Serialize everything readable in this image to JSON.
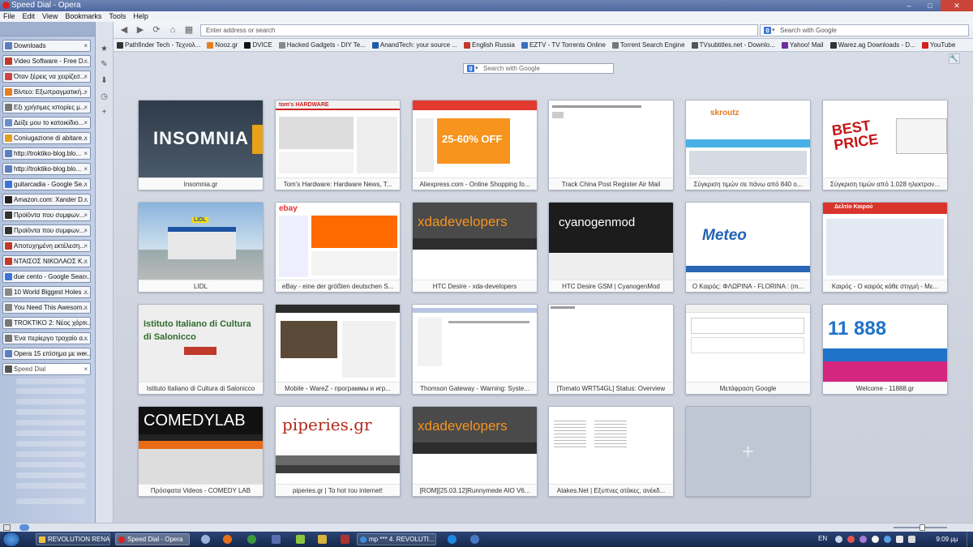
{
  "window": {
    "title": "Speed Dial - Opera"
  },
  "menu": [
    "File",
    "Edit",
    "View",
    "Bookmarks",
    "Tools",
    "Help"
  ],
  "tabs": [
    {
      "label": "Downloads",
      "color": "#5b7fbf"
    },
    {
      "label": "Video Software - Free D...",
      "color": "#c0392b"
    },
    {
      "label": "Όταν ξέρεις να χειρίζεσ...",
      "color": "#c44"
    },
    {
      "label": "Βίντεο: Εξωπραγματική...",
      "color": "#e67e22"
    },
    {
      "label": "Εξι χρήσιμες ιστορίες μ...",
      "color": "#777"
    },
    {
      "label": "Δείξε μου το κατοικίδιο...",
      "color": "#6a8fcf"
    },
    {
      "label": "Coniugazione di abitare...",
      "color": "#e2a020"
    },
    {
      "label": "http://troktiko-blog.blo...",
      "color": "#5b7fbf"
    },
    {
      "label": "http://troktiko-blog.blo...",
      "color": "#5b7fbf"
    },
    {
      "label": "guitarcadia - Google Se...",
      "color": "#3a75d8"
    },
    {
      "label": "Amazon.com: Xander D...",
      "color": "#222"
    },
    {
      "label": "Προϊόντα που συμφων...",
      "color": "#333"
    },
    {
      "label": "Προϊόντα που συμφων...",
      "color": "#333"
    },
    {
      "label": "Αποτυχημένη εκτέλεση...",
      "color": "#c0392b"
    },
    {
      "label": "ΝΤΑΙΣΟΣ ΝΙΚΟΛΑΟΣ Κ...",
      "color": "#c0392b"
    },
    {
      "label": "due cento - Google Sear...",
      "color": "#3a75d8"
    },
    {
      "label": "10 World Biggest Holes ...",
      "color": "#888"
    },
    {
      "label": "You Need This Awesom...",
      "color": "#888"
    },
    {
      "label": "TROKTIKO 2: Νέος χάρτ...",
      "color": "#777"
    },
    {
      "label": "Ένα περίεργο τροχαίο α...",
      "color": "#777"
    },
    {
      "label": "Opera 15 επίσημα με we...",
      "color": "#5b7fbf"
    },
    {
      "label": "Speed Dial",
      "color": "#555"
    }
  ],
  "toolbar": {
    "address_placeholder": "Enter address or search",
    "search_placeholder": "Search with Google"
  },
  "bookmarks": [
    {
      "label": "Pathfinder Tech - Τεχνολ...",
      "color": "#333"
    },
    {
      "label": "Nooz.gr",
      "color": "#e67e22"
    },
    {
      "label": "DVICE",
      "color": "#111"
    },
    {
      "label": "Hacked Gadgets - DIY Te...",
      "color": "#888"
    },
    {
      "label": "AnandTech: your source ...",
      "color": "#1e5aa8"
    },
    {
      "label": "English Russia",
      "color": "#c0392b"
    },
    {
      "label": "EZTV - TV Torrents Online",
      "color": "#3a6fbf"
    },
    {
      "label": "Torrent Search Engine",
      "color": "#777"
    },
    {
      "label": "TVsubtitles.net - Downlo...",
      "color": "#555"
    },
    {
      "label": "Yahoo! Mail",
      "color": "#6b2d9f"
    },
    {
      "label": "Warez.ag Downloads - D...",
      "color": "#333"
    },
    {
      "label": "YouTube",
      "color": "#d21f1f"
    }
  ],
  "speeddial": {
    "search_placeholder": "Search with Google",
    "dials": [
      {
        "caption": "Insomnia.gr",
        "thumb_text": "INSOMNIA"
      },
      {
        "caption": "Tom's Hardware: Hardware News, T...",
        "thumb_text": "tom's HARDWARE"
      },
      {
        "caption": "Aliexpress.com - Online Shopping fo...",
        "thumb_text": "25-60% OFF"
      },
      {
        "caption": "Track China Post Register Air Mail",
        "thumb_text": ""
      },
      {
        "caption": "Σύγκριση τιμών σε πάνω από 840 ο...",
        "thumb_text": "skroutz"
      },
      {
        "caption": "Σύγκριση τιμών από 1.028 ηλεκτρον...",
        "thumb_text": "BEST PRICE"
      },
      {
        "caption": "LIDL",
        "thumb_text": "LIDL"
      },
      {
        "caption": "eBay - eine der größten deutschen S...",
        "thumb_text": "ebay"
      },
      {
        "caption": "HTC Desire - xda-developers",
        "thumb_text": "xdadevelopers"
      },
      {
        "caption": "HTC Desire GSM | CyanogenMod",
        "thumb_text": "cyanogenmod"
      },
      {
        "caption": "Ο Καιρός: ΦΛΩΡΙΝΑ - FLORINA : (m...",
        "thumb_text": "Meteo"
      },
      {
        "caption": "Καιρός - Ο καιρός κάθε στιγμή - Με...",
        "thumb_text": "Δελτίο Καιρού"
      },
      {
        "caption": "Istituto Italiano di Cultura di Salonicco",
        "thumb_text": "Istituto Italiano di Cultura di Salonicco"
      },
      {
        "caption": "Mobile - WareZ - программы и игр...",
        "thumb_text": ""
      },
      {
        "caption": "Thomson Gateway - Warning: Syste...",
        "thumb_text": ""
      },
      {
        "caption": "[Tomato WRT54GL] Status: Overview",
        "thumb_text": ""
      },
      {
        "caption": "Μετάφραση Google",
        "thumb_text": ""
      },
      {
        "caption": "Welcome - 11888.gr",
        "thumb_text": "11 888"
      },
      {
        "caption": "Πρόσφατα Videos - COMEDY LAB",
        "thumb_text": "COMEDYLAB"
      },
      {
        "caption": "piperies.gr | Τα hot του internet!",
        "thumb_text": "piperies.gr"
      },
      {
        "caption": "[ROM][25.03.12]Runnymede AIO V6...",
        "thumb_text": "xdadevelopers"
      },
      {
        "caption": "Atakes.Net | Εξυπνες ατάκες, ανέκδ...",
        "thumb_text": ""
      },
      {
        "caption": "",
        "thumb_text": "+"
      }
    ]
  },
  "taskbar": {
    "items": [
      {
        "label": "REVOLUTION RENAL...",
        "color": "#f0c040"
      },
      {
        "label": "Speed Dial - Opera",
        "color": "#d8211f"
      },
      {
        "label": "mp *** 4. REVOLUTI...",
        "color": "#3b8de0"
      }
    ],
    "language": "EN",
    "time": "9:09 μμ"
  }
}
